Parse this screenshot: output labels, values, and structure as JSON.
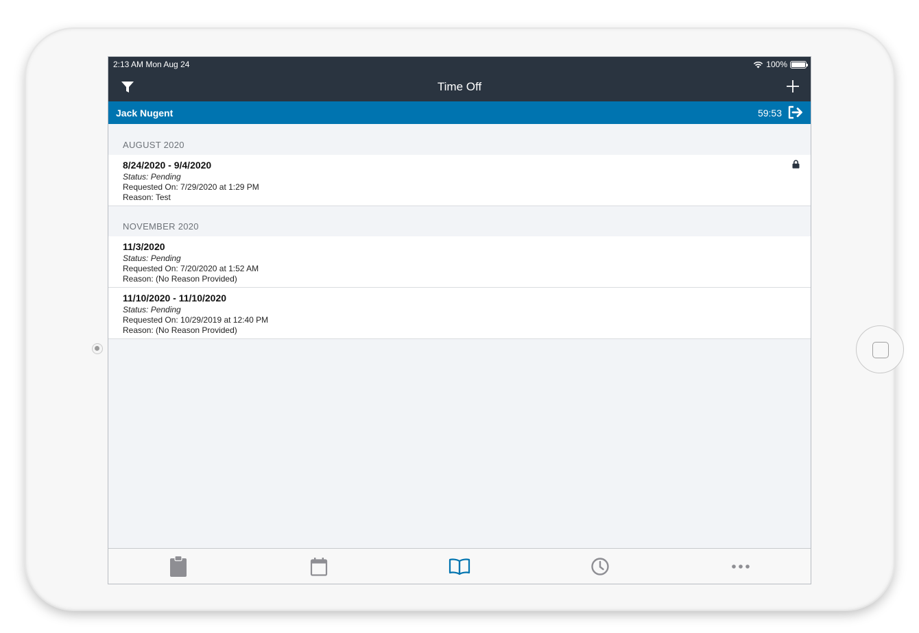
{
  "status_bar": {
    "time": "2:13 AM   Mon Aug 24",
    "battery": "100%"
  },
  "nav": {
    "title": "Time Off"
  },
  "user_bar": {
    "name": "Jack Nugent",
    "timer": "59:53"
  },
  "sections": [
    {
      "header": "AUGUST 2020",
      "items": [
        {
          "dates": "8/24/2020 - 9/4/2020",
          "status": "Status: Pending",
          "requested": "Requested On: 7/29/2020 at 1:29 PM",
          "reason": "Reason: Test",
          "locked": true
        }
      ]
    },
    {
      "header": "NOVEMBER 2020",
      "items": [
        {
          "dates": "11/3/2020",
          "status": "Status: Pending",
          "requested": "Requested On: 7/20/2020 at 1:52 AM",
          "reason": "Reason: (No Reason Provided)",
          "locked": false
        },
        {
          "dates": "11/10/2020 - 11/10/2020",
          "status": "Status: Pending",
          "requested": "Requested On: 10/29/2019 at 12:40 PM",
          "reason": "Reason: (No Reason Provided)",
          "locked": false
        }
      ]
    }
  ],
  "tabs": [
    {
      "icon": "clipboard-icon",
      "active": false
    },
    {
      "icon": "calendar-icon",
      "active": false
    },
    {
      "icon": "book-icon",
      "active": true
    },
    {
      "icon": "clock-icon",
      "active": false
    },
    {
      "icon": "more-icon",
      "active": false
    }
  ],
  "colors": {
    "header_bg": "#2a3440",
    "accent_blue": "#0074b0",
    "tab_inactive": "#8e8e93",
    "tab_active": "#0074b0",
    "list_bg": "#f2f4f7"
  }
}
